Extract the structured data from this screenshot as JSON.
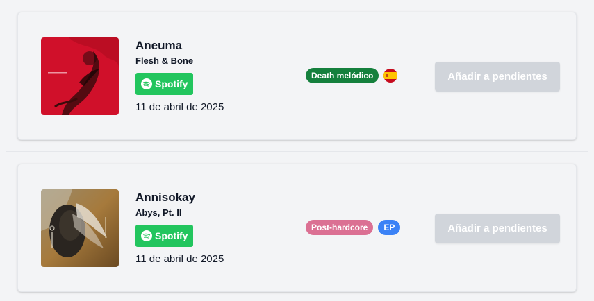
{
  "releases": [
    {
      "artist": "Aneuma",
      "album": "Flesh & Bone",
      "spotify_label": "Spotify",
      "date": "11 de abril de 2025",
      "tags": [
        {
          "label": "Death melódico",
          "color": "#15803d"
        }
      ],
      "flag": "spain-flag-icon",
      "action_label": "Añadir a pendientes"
    },
    {
      "artist": "Annisokay",
      "album": "Abys, Pt. II",
      "spotify_label": "Spotify",
      "date": "11 de abril de 2025",
      "tags": [
        {
          "label": "Post-hardcore",
          "color": "#db7093"
        },
        {
          "label": "EP",
          "color": "#3b82f6"
        }
      ],
      "action_label": "Añadir a pendientes"
    }
  ],
  "colors": {
    "spotify_green": "#22c55e",
    "disabled_button": "#d1d5db",
    "card_background": "#f3f4f6"
  }
}
